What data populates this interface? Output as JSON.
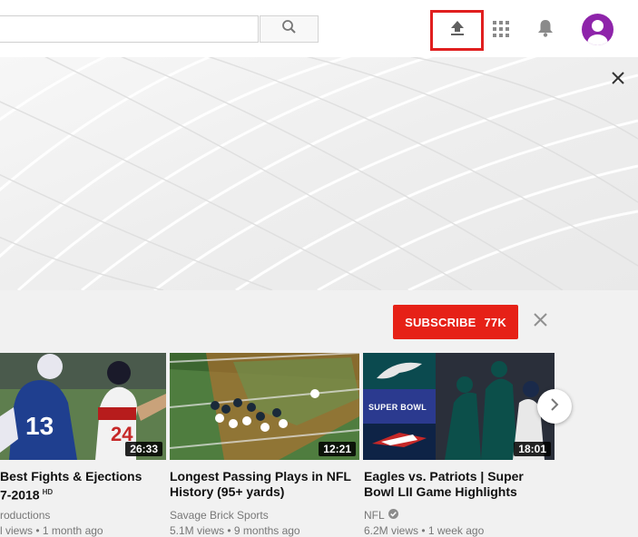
{
  "search": {
    "value": "",
    "placeholder": ""
  },
  "icons": {
    "search": "search-icon",
    "upload": "upload-icon",
    "apps": "apps-grid-icon",
    "notifications": "bell-icon",
    "avatar": "user-avatar-icon",
    "close": "close-icon",
    "next": "chevron-right-icon"
  },
  "colors": {
    "subscribe": "#e62117",
    "highlight": "#e01f1f",
    "avatar": "#8e24aa"
  },
  "channel": {
    "subscribe_label": "SUBSCRIBE",
    "subscriber_count": "77K"
  },
  "videos": [
    {
      "title_line1": "Best Fights & Ejections",
      "title_line2": "7-2018",
      "badge": "HD",
      "channel": "roductions",
      "meta": "l views • 1 month ago",
      "duration": "26:33"
    },
    {
      "title_line1": "Longest Passing Plays in NFL",
      "title_line2": "History (95+ yards)",
      "badge": "",
      "channel": "Savage Brick Sports",
      "meta": "5.1M views • 9 months ago",
      "duration": "12:21"
    },
    {
      "title_line1": "Eagles vs. Patriots | Super",
      "title_line2": "Bowl LII Game Highlights",
      "badge": "",
      "channel": "NFL",
      "meta": "6.2M views • 1 week ago",
      "duration": "18:01"
    }
  ],
  "thumb3_text": {
    "super_bowl": "SUPER BOWL"
  }
}
